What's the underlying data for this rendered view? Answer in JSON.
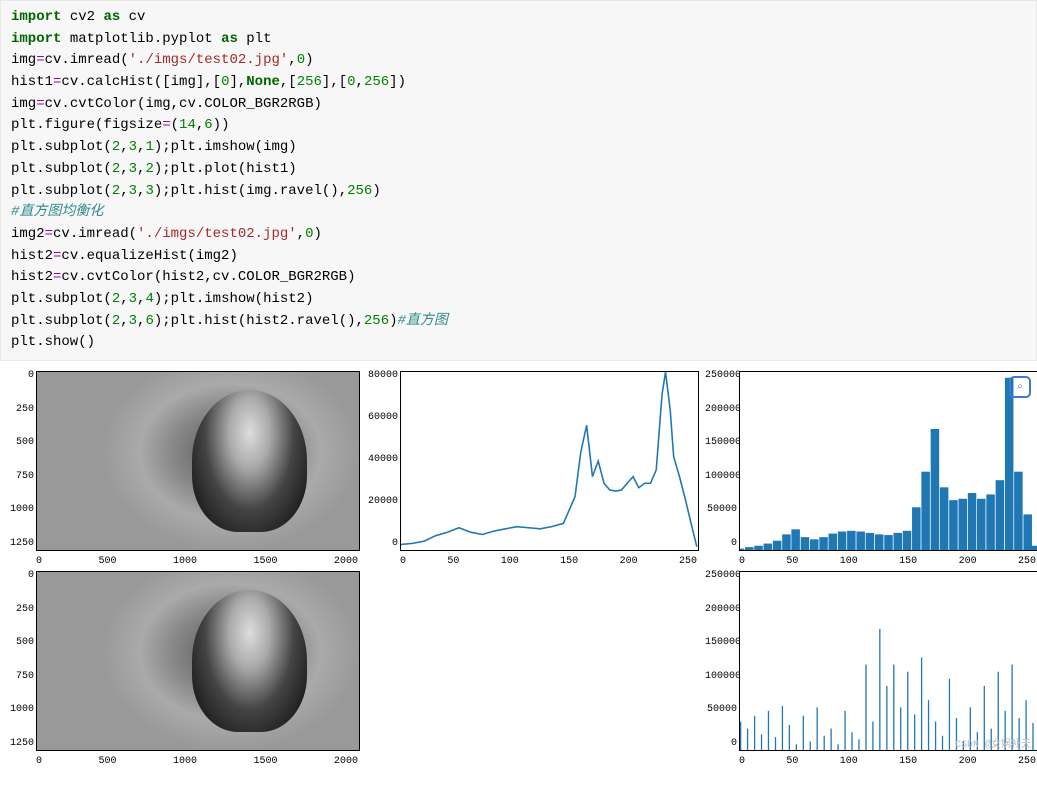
{
  "code_tokens": [
    {
      "t": "kw",
      "v": "import"
    },
    {
      "v": " cv2 "
    },
    {
      "t": "kw",
      "v": "as"
    },
    {
      "v": " cv\n"
    },
    {
      "t": "kw",
      "v": "import"
    },
    {
      "v": " matplotlib.pyplot "
    },
    {
      "t": "kw",
      "v": "as"
    },
    {
      "v": " plt\n"
    },
    {
      "v": "img"
    },
    {
      "t": "op",
      "v": "="
    },
    {
      "v": "cv.imread("
    },
    {
      "t": "str",
      "v": "'./imgs/test02.jpg'"
    },
    {
      "v": ","
    },
    {
      "t": "num",
      "v": "0"
    },
    {
      "v": ")\n"
    },
    {
      "v": "hist1"
    },
    {
      "t": "op",
      "v": "="
    },
    {
      "v": "cv.calcHist([img],["
    },
    {
      "t": "num",
      "v": "0"
    },
    {
      "v": "],"
    },
    {
      "t": "bi",
      "v": "None"
    },
    {
      "v": ",["
    },
    {
      "t": "num",
      "v": "256"
    },
    {
      "v": "],["
    },
    {
      "t": "num",
      "v": "0"
    },
    {
      "v": ","
    },
    {
      "t": "num",
      "v": "256"
    },
    {
      "v": "])\n"
    },
    {
      "v": "img"
    },
    {
      "t": "op",
      "v": "="
    },
    {
      "v": "cv.cvtColor(img,cv.COLOR_BGR2RGB)\n"
    },
    {
      "v": "plt.figure(figsize"
    },
    {
      "t": "op",
      "v": "="
    },
    {
      "v": "("
    },
    {
      "t": "num",
      "v": "14"
    },
    {
      "v": ","
    },
    {
      "t": "num",
      "v": "6"
    },
    {
      "v": "))\n"
    },
    {
      "v": "plt.subplot("
    },
    {
      "t": "num",
      "v": "2"
    },
    {
      "v": ","
    },
    {
      "t": "num",
      "v": "3"
    },
    {
      "v": ","
    },
    {
      "t": "num",
      "v": "1"
    },
    {
      "v": ");plt.imshow(img)\n"
    },
    {
      "v": "plt.subplot("
    },
    {
      "t": "num",
      "v": "2"
    },
    {
      "v": ","
    },
    {
      "t": "num",
      "v": "3"
    },
    {
      "v": ","
    },
    {
      "t": "num",
      "v": "2"
    },
    {
      "v": ");plt.plot(hist1)\n"
    },
    {
      "v": "plt.subplot("
    },
    {
      "t": "num",
      "v": "2"
    },
    {
      "v": ","
    },
    {
      "t": "num",
      "v": "3"
    },
    {
      "v": ","
    },
    {
      "t": "num",
      "v": "3"
    },
    {
      "v": ");plt.hist(img.ravel(),"
    },
    {
      "t": "num",
      "v": "256"
    },
    {
      "v": ")\n"
    },
    {
      "t": "cm",
      "v": "#直方图均衡化"
    },
    {
      "v": "\n"
    },
    {
      "v": "img2"
    },
    {
      "t": "op",
      "v": "="
    },
    {
      "v": "cv.imread("
    },
    {
      "t": "str",
      "v": "'./imgs/test02.jpg'"
    },
    {
      "v": ","
    },
    {
      "t": "num",
      "v": "0"
    },
    {
      "v": ")\n"
    },
    {
      "v": "hist2"
    },
    {
      "t": "op",
      "v": "="
    },
    {
      "v": "cv.equalizeHist(img2)\n"
    },
    {
      "v": "hist2"
    },
    {
      "t": "op",
      "v": "="
    },
    {
      "v": "cv.cvtColor(hist2,cv.COLOR_BGR2RGB)\n"
    },
    {
      "v": "plt.subplot("
    },
    {
      "t": "num",
      "v": "2"
    },
    {
      "v": ","
    },
    {
      "t": "num",
      "v": "3"
    },
    {
      "v": ","
    },
    {
      "t": "num",
      "v": "4"
    },
    {
      "v": ");plt.imshow(hist2)\n"
    },
    {
      "v": "plt.subplot("
    },
    {
      "t": "num",
      "v": "2"
    },
    {
      "v": ","
    },
    {
      "t": "num",
      "v": "3"
    },
    {
      "v": ","
    },
    {
      "t": "num",
      "v": "6"
    },
    {
      "v": ");plt.hist(hist2.ravel(),"
    },
    {
      "t": "num",
      "v": "256"
    },
    {
      "v": ")"
    },
    {
      "t": "cm",
      "v": "#直方图"
    },
    {
      "v": "\n"
    },
    {
      "v": "plt.show()"
    }
  ],
  "chart_data": [
    {
      "type": "image",
      "subplot": 1,
      "xticks": [
        "0",
        "500",
        "1000",
        "1500",
        "2000"
      ],
      "yticks": [
        "0",
        "250",
        "500",
        "750",
        "1000",
        "1250"
      ]
    },
    {
      "type": "line",
      "subplot": 2,
      "xlabel": "",
      "ylabel": "",
      "xlim": [
        0,
        256
      ],
      "ylim": [
        0,
        80000
      ],
      "xticks": [
        "0",
        "50",
        "100",
        "150",
        "200",
        "250"
      ],
      "yticks": [
        "0",
        "20000",
        "40000",
        "60000",
        "80000"
      ],
      "x": [
        0,
        10,
        20,
        30,
        40,
        50,
        60,
        70,
        80,
        90,
        100,
        110,
        120,
        130,
        140,
        150,
        155,
        160,
        165,
        170,
        175,
        180,
        185,
        190,
        195,
        200,
        205,
        210,
        215,
        220,
        225,
        228,
        232,
        235,
        240,
        245,
        250,
        255
      ],
      "y": [
        2500,
        3000,
        4000,
        6500,
        8000,
        10000,
        8000,
        7000,
        8500,
        9500,
        10500,
        10000,
        9500,
        10500,
        12000,
        24000,
        44000,
        56000,
        33000,
        40000,
        30000,
        27000,
        26500,
        27000,
        30000,
        33000,
        28000,
        30000,
        30000,
        36000,
        70000,
        80000,
        63000,
        42000,
        33000,
        23000,
        12000,
        1500
      ]
    },
    {
      "type": "bar",
      "subplot": 3,
      "xlabel": "",
      "ylabel": "",
      "xlim": [
        0,
        256
      ],
      "ylim": [
        0,
        250000
      ],
      "xticks": [
        "0",
        "50",
        "100",
        "150",
        "200",
        "250"
      ],
      "yticks": [
        "0",
        "50000",
        "100000",
        "150000",
        "200000",
        "250000"
      ],
      "categories": [
        0,
        8,
        16,
        24,
        32,
        40,
        48,
        56,
        64,
        72,
        80,
        88,
        96,
        104,
        112,
        120,
        128,
        136,
        144,
        152,
        160,
        168,
        176,
        184,
        192,
        200,
        208,
        216,
        224,
        232,
        240,
        248,
        255
      ],
      "values": [
        2000,
        4000,
        6000,
        9000,
        13000,
        22000,
        29000,
        18000,
        15000,
        18000,
        23000,
        26000,
        27000,
        26000,
        24000,
        22000,
        21000,
        24000,
        27000,
        60000,
        110000,
        170000,
        88000,
        70000,
        72000,
        80000,
        72000,
        78000,
        98000,
        242000,
        110000,
        50000,
        6000
      ]
    },
    {
      "type": "image",
      "subplot": 4,
      "xticks": [
        "0",
        "500",
        "1000",
        "1500",
        "2000"
      ],
      "yticks": [
        "0",
        "250",
        "500",
        "750",
        "1000",
        "1250"
      ]
    },
    {
      "type": "bar",
      "subplot": 6,
      "xlabel": "",
      "ylabel": "",
      "xlim": [
        0,
        256
      ],
      "ylim": [
        0,
        250000
      ],
      "xticks": [
        "0",
        "50",
        "100",
        "150",
        "200",
        "250"
      ],
      "yticks": [
        "0",
        "50000",
        "100000",
        "150000",
        "200000",
        "250000"
      ],
      "categories": [
        0,
        6,
        12,
        18,
        24,
        30,
        36,
        42,
        48,
        54,
        60,
        66,
        72,
        78,
        84,
        90,
        96,
        102,
        108,
        114,
        120,
        126,
        132,
        138,
        144,
        150,
        156,
        162,
        168,
        174,
        180,
        186,
        192,
        198,
        204,
        210,
        216,
        222,
        228,
        234,
        240,
        246,
        252
      ],
      "values": [
        40000,
        30000,
        48000,
        22000,
        55000,
        18000,
        62000,
        35000,
        8000,
        48000,
        12000,
        60000,
        20000,
        30000,
        8000,
        55000,
        25000,
        15000,
        120000,
        40000,
        170000,
        90000,
        120000,
        60000,
        110000,
        50000,
        130000,
        70000,
        40000,
        20000,
        100000,
        45000,
        12000,
        60000,
        25000,
        90000,
        30000,
        110000,
        55000,
        120000,
        45000,
        70000,
        38000
      ]
    }
  ],
  "icons": {
    "badge": "⌕"
  },
  "watermark": "CSDN @女娲补天"
}
